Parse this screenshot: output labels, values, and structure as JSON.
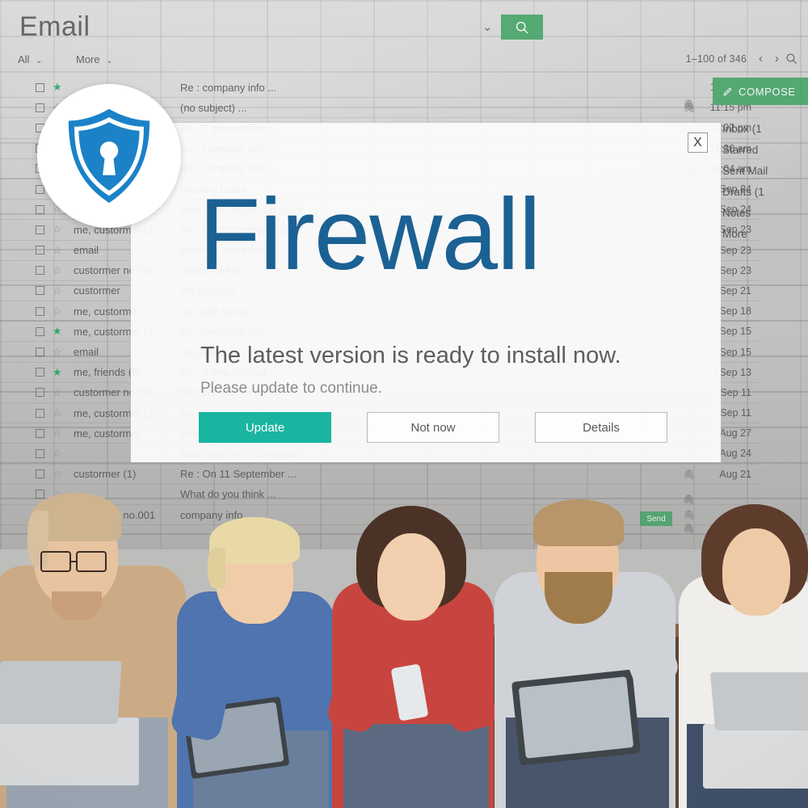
{
  "app": {
    "title": "Email",
    "search_icon": "search-icon",
    "search_caret": "⌄"
  },
  "toolbar": {
    "all_label": "All",
    "more_label": "More",
    "caret": "⌄",
    "pagination": "1–100 of 346",
    "prev_icon": "‹",
    "next_icon": "›",
    "search_icon": "search-icon"
  },
  "right_rail": {
    "compose_label": "COMPOSE",
    "compose_icon": "pencil-icon",
    "items": [
      {
        "label": "Inbox  (1"
      },
      {
        "label": "Starred"
      },
      {
        "label": "Sent Mail"
      },
      {
        "label": "Drafts  (1"
      },
      {
        "label": "Notes"
      },
      {
        "label": "More"
      }
    ],
    "send_label": "Send"
  },
  "mail_list": {
    "rows": [
      {
        "starred": true,
        "sender": "",
        "subject": "Re : company info ...",
        "time": "11:27 pm",
        "clip": false
      },
      {
        "starred": false,
        "sender": "",
        "subject": "(no subject) ...",
        "time": "11:15 pm",
        "clip": true
      },
      {
        "starred": false,
        "sender": "",
        "subject": "Re : 2 new notifica ...",
        "time": "10:02 pm",
        "clip": false
      },
      {
        "starred": false,
        "sender": "",
        "subject": "Re : company info ...",
        "time": "10:30 am",
        "clip": false
      },
      {
        "starred": false,
        "sender": "",
        "subject": "Re : company info ...",
        "time": "09:04 am",
        "clip": true
      },
      {
        "starred": false,
        "sender": "",
        "subject": "Meeting today",
        "time": "Sep 24",
        "clip": false
      },
      {
        "starred": false,
        "sender": "",
        "subject": "New Sign–in on Computer",
        "time": "Sep 24",
        "clip": false
      },
      {
        "starred": false,
        "sender": "me, custormer (2)",
        "subject": "Re : On 2 October at 09:00",
        "time": "Sep 23",
        "clip": false
      },
      {
        "starred": false,
        "sender": "email",
        "subject": "What do you think ...",
        "time": "Sep 23",
        "clip": false
      },
      {
        "starred": false,
        "sender": "custormer no.005",
        "subject": "company info ...",
        "time": "Sep 23",
        "clip": false
      },
      {
        "starred": false,
        "sender": "custormer",
        "subject": "(no subject) ...",
        "time": "Sep 21",
        "clip": false
      },
      {
        "starred": false,
        "sender": "me, custormer",
        "subject": "we want some ...",
        "time": "Sep 18",
        "clip": false
      },
      {
        "starred": true,
        "sender": "me, custormer (3)",
        "subject": "Re : company info ...",
        "time": "Sep 15",
        "clip": false
      },
      {
        "starred": false,
        "sender": "email",
        "subject": "(no subject) ...",
        "time": "Sep 15",
        "clip": false
      },
      {
        "starred": true,
        "sender": "me, friends (6)",
        "subject": "Re : 2 new notifica ...",
        "time": "Sep 13",
        "clip": false
      },
      {
        "starred": false,
        "sender": "custormer no.24",
        "subject": "Re : company info ...",
        "time": "Sep 11",
        "clip": false
      },
      {
        "starred": false,
        "sender": "me, custormer (2)",
        "subject": "Re : company info ...",
        "time": "Sep 11",
        "clip": false
      },
      {
        "starred": false,
        "sender": "me, custormer",
        "subject": "Meeting today ...",
        "time": "Aug 27",
        "clip": false
      },
      {
        "starred": false,
        "sender": "",
        "subject": "New Sign–in on Computer ...",
        "time": "Aug 24",
        "clip": false
      },
      {
        "starred": false,
        "sender": "custormer (1)",
        "subject": "Re : On 11 September ...",
        "time": "Aug 21",
        "clip": true
      },
      {
        "starred": false,
        "sender": "",
        "subject": "What do you think ...",
        "time": "",
        "clip": false
      },
      {
        "starred": false,
        "sender": "custormer no.001",
        "subject": "company info ...",
        "time": "",
        "clip": true
      }
    ]
  },
  "dialog": {
    "title": "Firewall",
    "close_label": "X",
    "headline": "The latest version is ready to install now.",
    "note": "Please update to continue.",
    "buttons": [
      {
        "label": "Update",
        "style": "primary",
        "name": "update-button"
      },
      {
        "label": "Not now",
        "style": "ghost",
        "name": "not-now-button"
      },
      {
        "label": "Details",
        "style": "ghost",
        "name": "details-button"
      }
    ]
  },
  "badge": {
    "icon": "shield-lock-icon"
  },
  "colors": {
    "title_blue": "#1b6193",
    "shield_blue": "#1b82c8",
    "primary_button": "#19b5a1",
    "mail_green": "#3aa05e",
    "star_green": "#16a05a"
  }
}
